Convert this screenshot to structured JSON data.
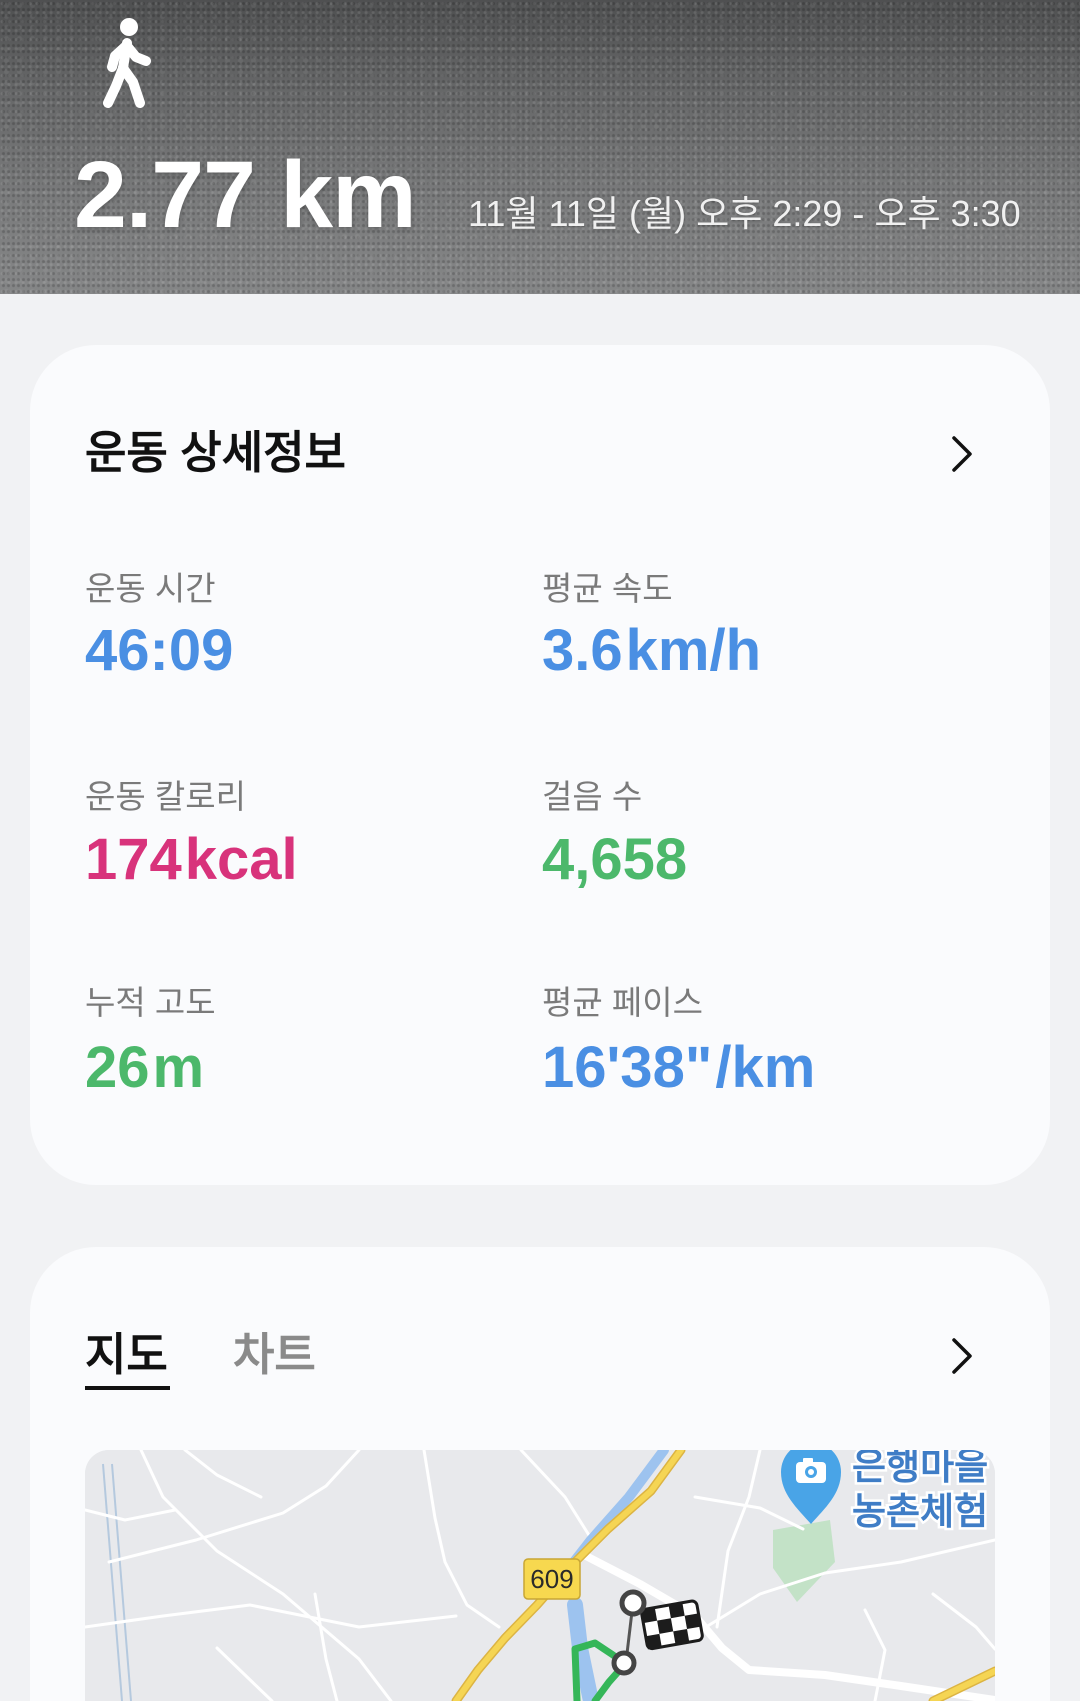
{
  "header": {
    "activity_icon": "walking-icon",
    "distance": "2.77 km",
    "datetime": "11월 11일 (월) 오후 2:29 - 오후 3:30"
  },
  "details_card": {
    "title": "운동 상세정보",
    "chevron_icon": "chevron-right-icon",
    "stats": [
      {
        "label": "운동 시간",
        "value": "46:09",
        "color": "#4a8fe3"
      },
      {
        "label": "평균 속도",
        "value": "3.6",
        "unit": "km/h",
        "color": "#4a8fe3"
      },
      {
        "label": "운동 칼로리",
        "value": "174",
        "unit": "kcal",
        "color": "#d8337b"
      },
      {
        "label": "걸음 수",
        "value": "4,658",
        "color": "#4cb86b"
      },
      {
        "label": "누적 고도",
        "value": "26",
        "unit": "m",
        "color": "#4cb86b"
      },
      {
        "label": "평균 페이스",
        "value": "16'38\"",
        "unit": "/km",
        "color": "#4a8fe3"
      }
    ]
  },
  "map_card": {
    "tabs": [
      {
        "label": "지도",
        "selected": true
      },
      {
        "label": "차트",
        "selected": false
      }
    ],
    "chevron_icon": "chevron-right-icon",
    "map": {
      "road_number": "609",
      "poi_label_line1": "은행마을",
      "poi_label_line2": "농촌체험",
      "poi_icon": "camera-pin-icon",
      "finish_icon": "checkered-flag-icon"
    }
  },
  "colors": {
    "background": "#f1f2f4",
    "card": "#fafbfd",
    "route_green": "#35b659",
    "highway_yellow": "#f5d554",
    "poi_blue": "#49a4e7",
    "poi_text": "#3f7dc6"
  }
}
